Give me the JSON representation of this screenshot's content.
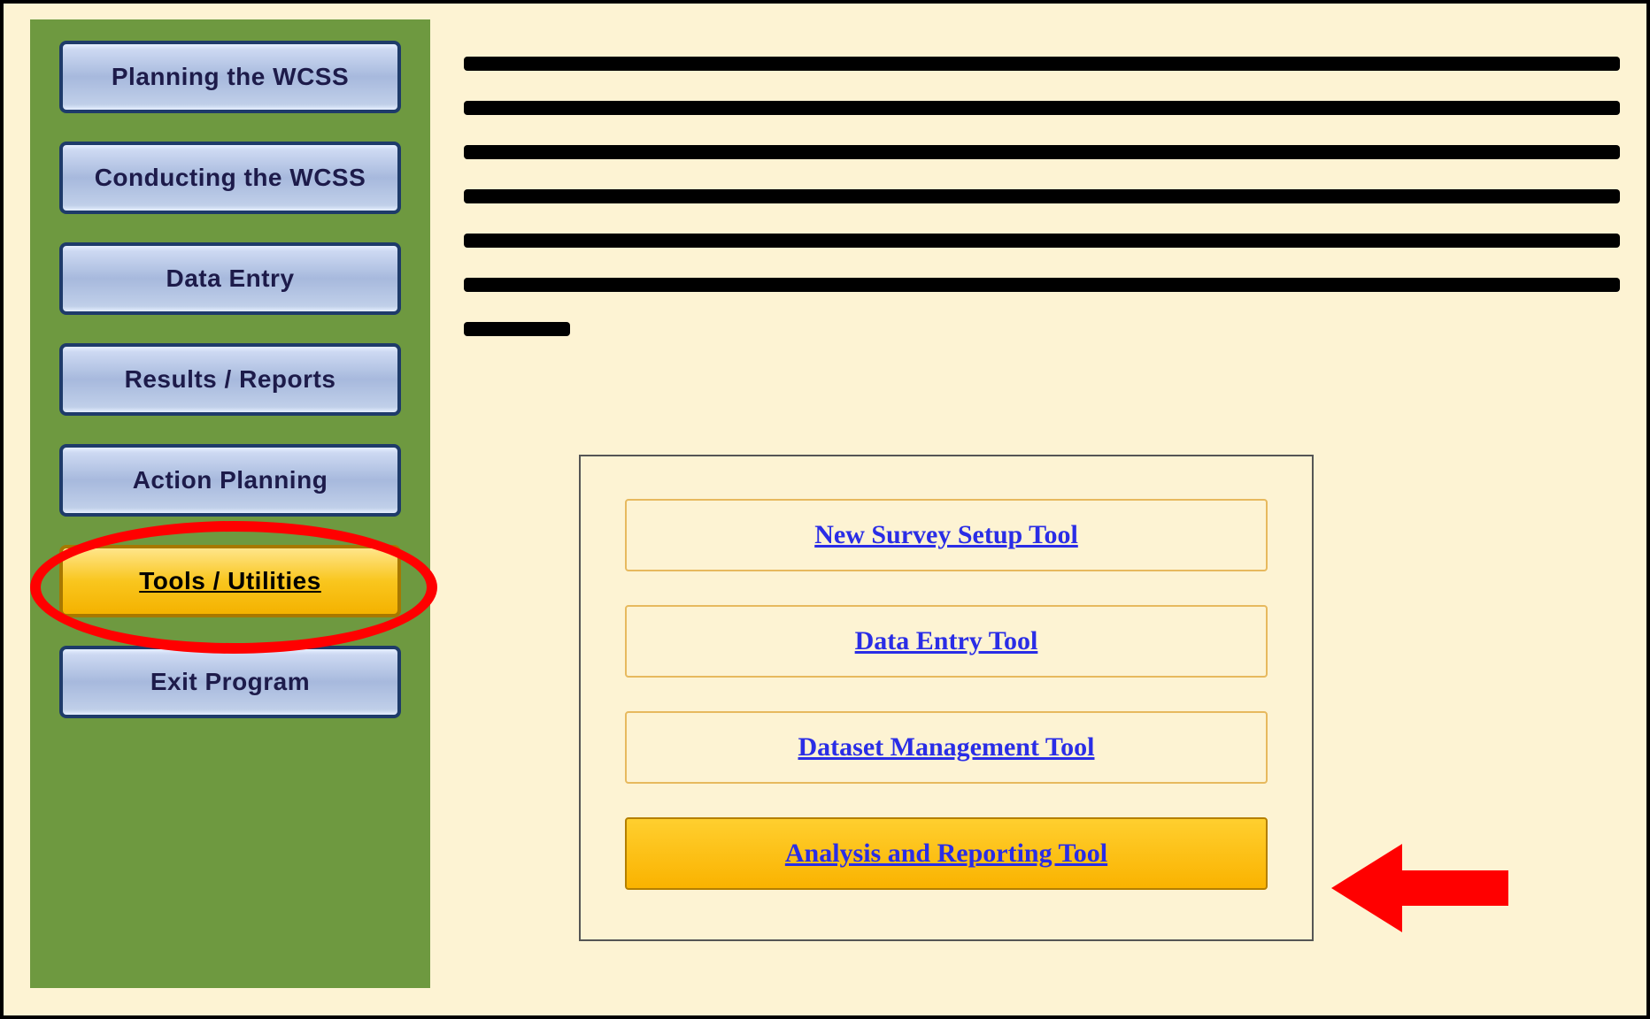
{
  "sidebar": {
    "items": [
      {
        "label": "Planning the WCSS"
      },
      {
        "label": "Conducting the WCSS"
      },
      {
        "label": "Data Entry"
      },
      {
        "label": "Results / Reports"
      },
      {
        "label": "Action Planning"
      },
      {
        "label": "Tools / Utilities"
      },
      {
        "label": "Exit Program"
      }
    ],
    "selected_index": 5
  },
  "tools_panel": {
    "items": [
      {
        "label": "New Survey Setup Tool"
      },
      {
        "label": "Data Entry Tool"
      },
      {
        "label": "Dataset Management Tool"
      },
      {
        "label": "Analysis and Reporting Tool"
      }
    ],
    "highlighted_index": 3
  },
  "redacted_lines": 7
}
